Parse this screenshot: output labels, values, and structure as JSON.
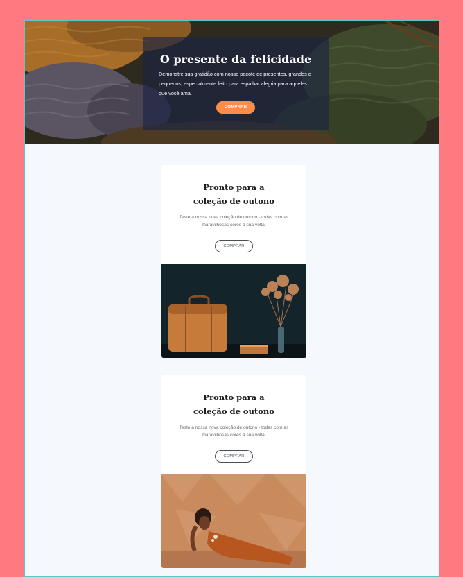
{
  "hero": {
    "title": "O presente da felicidade",
    "text": "Demonstre sua gratidão com nosso pacote de presentes, grandes e pequenos, especialmente feito para espalhar alegria para aqueles que você ama.",
    "button_label": "COMPRAR",
    "image_icon": "knitted-sweaters-photo"
  },
  "cards": [
    {
      "title_line1": "Pronto para a",
      "title_line2": "coleção de outono",
      "text": "Teste a nossa nova coleção de outono - todas com as maravilhosas cores a sua volta.",
      "button_label": "COMPRAR",
      "image_icon": "leather-bag-photo"
    },
    {
      "title_line1": "Pronto para a",
      "title_line2": "coleção de outono",
      "text": "Teste a nossa nova coleção de outono - todas com as maravilhosas cores a sua volta.",
      "button_label": "COMPRAR",
      "image_icon": "woman-orange-dress-photo"
    }
  ],
  "colors": {
    "page_background": "#ff7a80",
    "content_background": "#f5f8fc",
    "accent_button": "#ff8c47",
    "hero_overlay": "#182346"
  }
}
